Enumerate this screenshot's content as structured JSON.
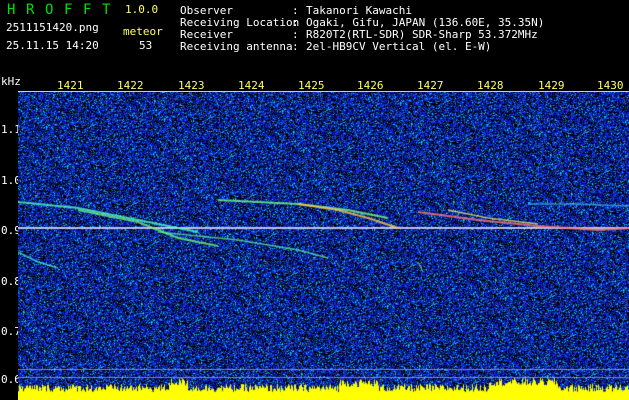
{
  "app": {
    "logo_letters": [
      "H",
      "R",
      "O",
      "F",
      "F",
      "T"
    ],
    "version": "1.0.0"
  },
  "meta": {
    "filename": "2511151420.png",
    "datetime": "25.11.15 14:20",
    "meteor_label": "meteor",
    "meteor_count": "53"
  },
  "info": {
    "rows": [
      {
        "label": "Observer",
        "sep": ":",
        "value": "Takanori Kawachi"
      },
      {
        "label": "Receiving Location",
        "sep": ":",
        "value": "Ogaki, Gifu, JAPAN (136.60E, 35.35N)"
      },
      {
        "label": "Receiver",
        "sep": ":",
        "value": "R820T2(RTL-SDR) SDR-Sharp 53.372MHz"
      },
      {
        "label": "Receiving antenna",
        "sep": ":",
        "value": "2el-HB9CV Vertical (el. E-W)"
      }
    ]
  },
  "axes": {
    "y_unit": "kHz",
    "y_ticks": [
      "1.1",
      "1.0",
      "0.9",
      "0.8",
      "0.7",
      "0.6"
    ],
    "x_ticks": [
      "1421",
      "1422",
      "1423",
      "1424",
      "1425",
      "1426",
      "1427",
      "1428",
      "1429",
      "1430"
    ]
  },
  "colors": {
    "background": "#000000",
    "header_green": "#00e000",
    "header_yellow": "#ffff66",
    "spectrum_yellow": "#ffff00",
    "carrier_line": "#d8d8ff",
    "noise_blue": "#1a2ad0"
  }
}
